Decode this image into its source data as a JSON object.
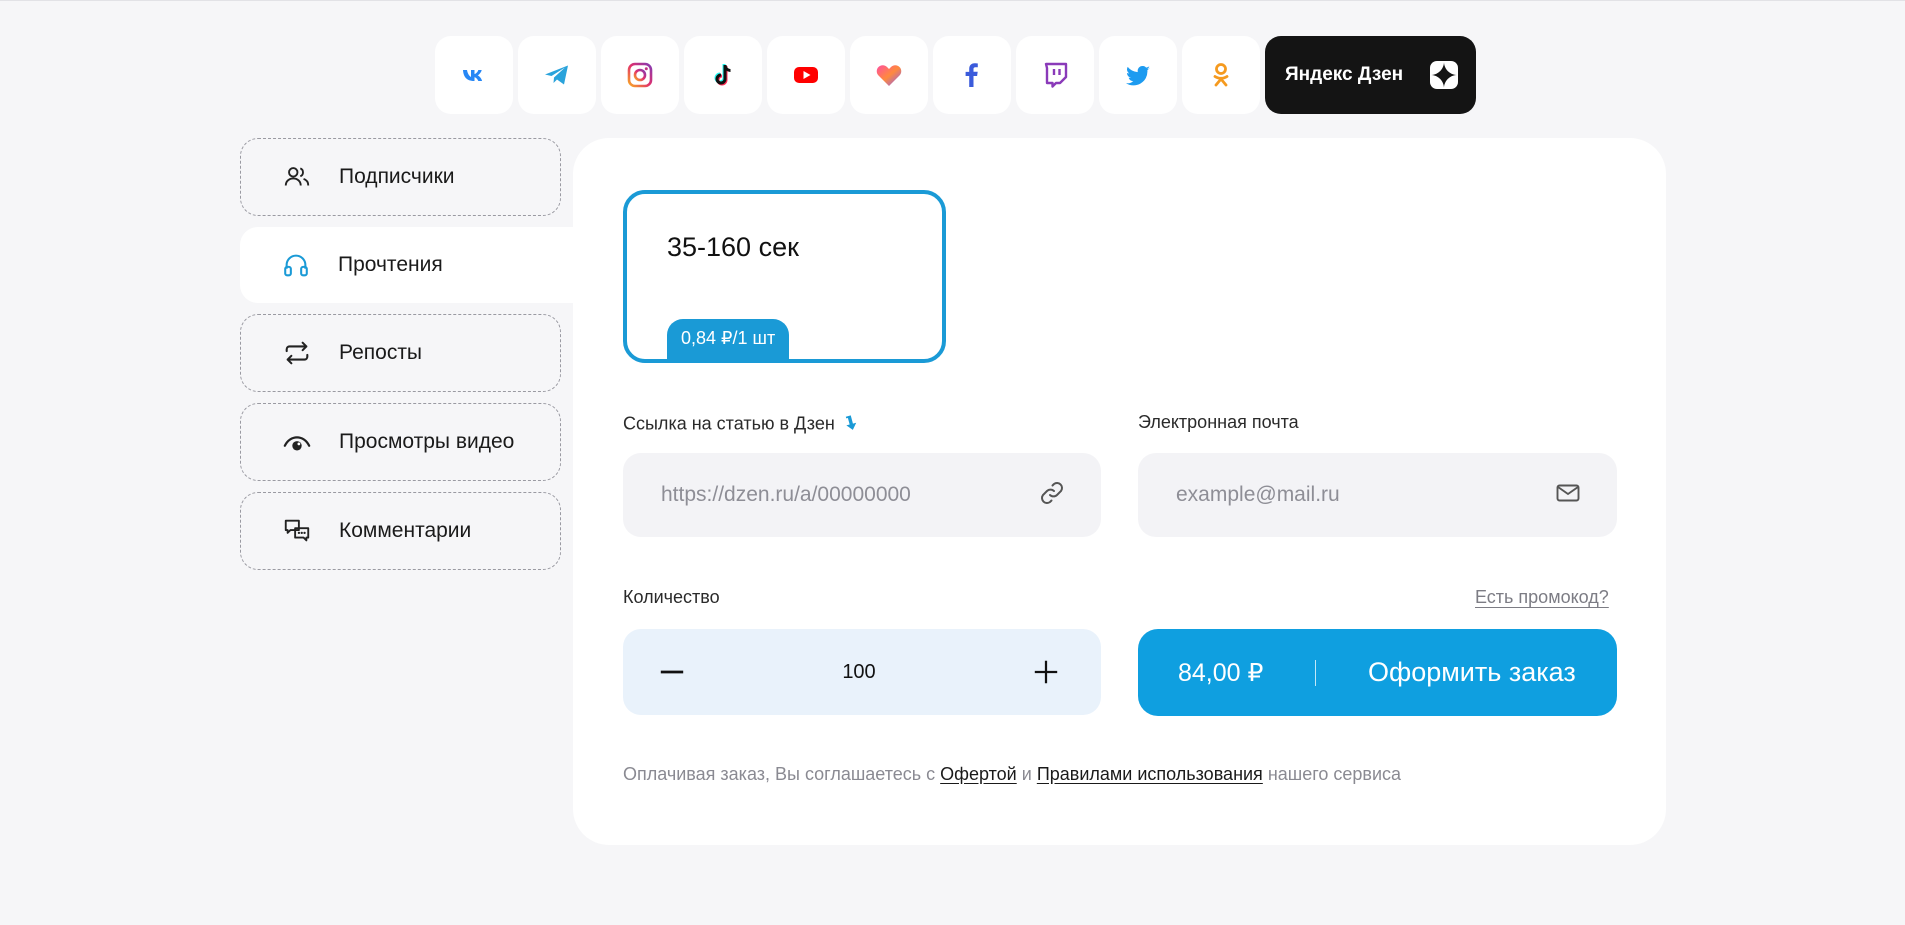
{
  "social": {
    "items": [
      {
        "icon": "vk-icon",
        "color": "#2787f5"
      },
      {
        "icon": "telegram-icon",
        "color": "#2aa3db"
      },
      {
        "icon": "instagram-icon",
        "color": "#e1306c"
      },
      {
        "icon": "tiktok-icon",
        "color": "#111111"
      },
      {
        "icon": "youtube-icon",
        "color": "#ff0000"
      },
      {
        "icon": "likee-icon",
        "color": "#ff4fa0"
      },
      {
        "icon": "facebook-icon",
        "color": "#1877f2"
      },
      {
        "icon": "twitch-icon",
        "color": "#8a3ab9"
      },
      {
        "icon": "twitter-icon",
        "color": "#1da1f2"
      },
      {
        "icon": "odnoklassniki-icon",
        "color": "#f59a1f"
      }
    ],
    "active_label": "Яндекс Дзен"
  },
  "sidebar": {
    "items": [
      {
        "label": "Подписчики",
        "icon": "users-icon"
      },
      {
        "label": "Прочтения",
        "icon": "headphones-icon",
        "active": true
      },
      {
        "label": "Репосты",
        "icon": "repost-icon"
      },
      {
        "label": "Просмотры видео",
        "icon": "eye-icon"
      },
      {
        "label": "Комментарии",
        "icon": "comments-icon"
      }
    ]
  },
  "tariff": {
    "time": "35-160 сек",
    "price": "0,84 ₽/1 шт",
    "accent": "#1a9ad6"
  },
  "form": {
    "link_label": "Ссылка на статью в Дзен",
    "link_placeholder": "https://dzen.ru/a/00000000",
    "email_label": "Электронная почта",
    "email_placeholder": "example@mail.ru",
    "qty_label": "Количество",
    "promo_label": "Есть промокод?",
    "qty_value": "100",
    "order_sum": "84,00 ₽",
    "order_label": "Оформить заказ",
    "order_color": "#0f9fe0"
  },
  "consent": {
    "prefix": "Оплачивая заказ, Вы соглашаетесь с",
    "offer_link": "Офертой",
    "and": "и",
    "rules_link": "Правилами использования",
    "suffix": "нашего сервиса"
  }
}
